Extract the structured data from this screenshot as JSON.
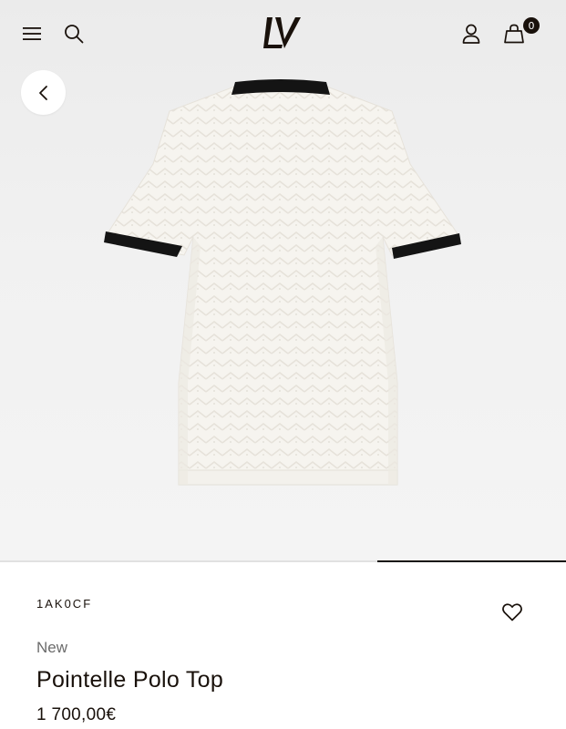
{
  "header": {
    "menu_icon": "hamburger-icon",
    "search_icon": "search-icon",
    "logo": "LV",
    "account_icon": "user-icon",
    "bag_icon": "shopping-bag-icon",
    "bag_count": "0"
  },
  "gallery": {
    "back_icon": "chevron-left-icon",
    "image": "product-photo-polo-back",
    "active_slide": 3,
    "total_slides": 3
  },
  "product": {
    "sku": "1AK0CF",
    "badge": "New",
    "name": "Pointelle Polo Top",
    "price": "1 700,00€",
    "wishlist_icon": "heart-icon"
  },
  "colors": {
    "ink": "#19110b",
    "muted": "#6b6b6b",
    "background": "#f1f1f1"
  }
}
